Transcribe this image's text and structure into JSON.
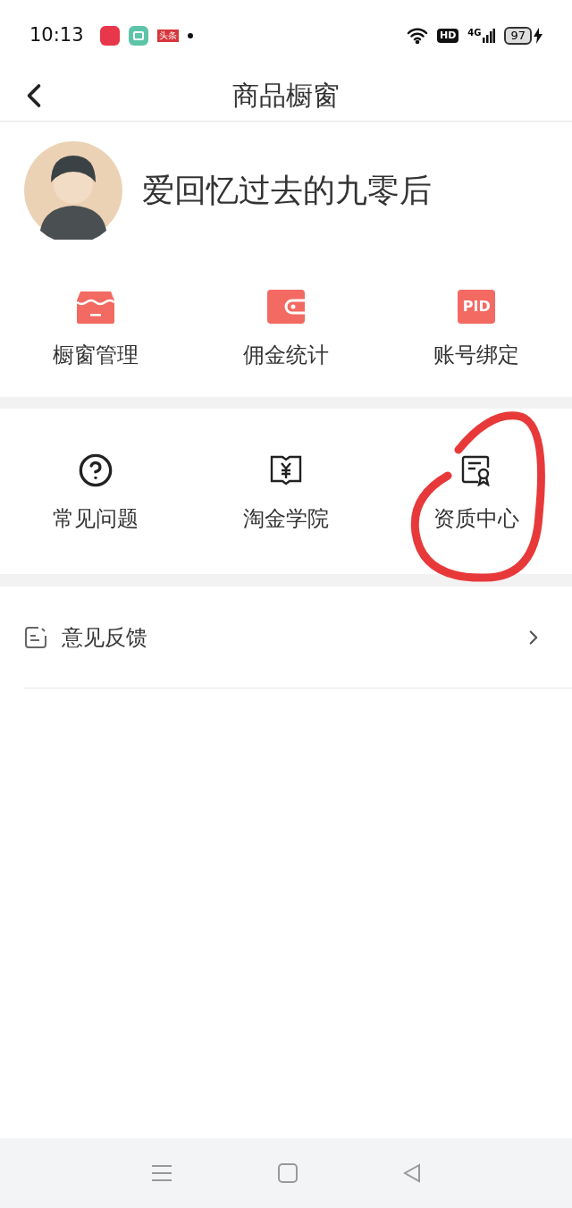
{
  "status_bar": {
    "time": "10:13",
    "app_badge": "头条",
    "hd": "HD",
    "network": "4G",
    "battery": "97"
  },
  "header": {
    "title": "商品橱窗"
  },
  "profile": {
    "name": "爱回忆过去的九零后"
  },
  "primary_actions": [
    {
      "label": "橱窗管理",
      "kind": "store"
    },
    {
      "label": "佣金统计",
      "kind": "wallet"
    },
    {
      "label": "账号绑定",
      "kind": "pid",
      "icon_text": "PID"
    }
  ],
  "secondary_actions": [
    {
      "label": "常见问题",
      "kind": "help"
    },
    {
      "label": "淘金学院",
      "kind": "book"
    },
    {
      "label": "资质中心",
      "kind": "certificate"
    }
  ],
  "menu": [
    {
      "label": "意见反馈",
      "kind": "feedback"
    }
  ]
}
